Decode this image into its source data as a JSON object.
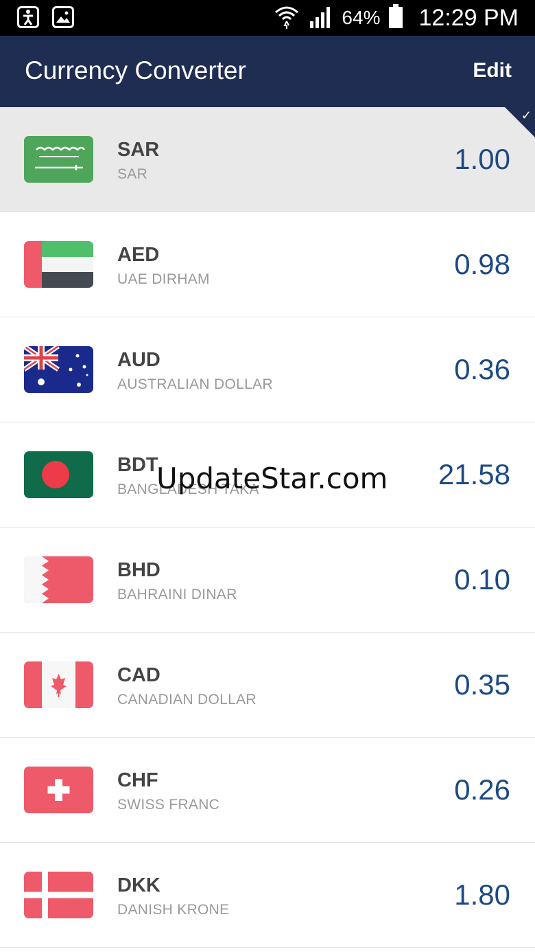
{
  "status_bar": {
    "battery": "64%",
    "time": "12:29 PM"
  },
  "app_bar": {
    "title": "Currency Converter",
    "edit_label": "Edit"
  },
  "currencies": [
    {
      "code": "SAR",
      "name": "SAR",
      "value": "1.00",
      "selected": true
    },
    {
      "code": "AED",
      "name": "UAE DIRHAM",
      "value": "0.98"
    },
    {
      "code": "AUD",
      "name": "AUSTRALIAN DOLLAR",
      "value": "0.36"
    },
    {
      "code": "BDT",
      "name": "BANGLADESH TAKA",
      "value": "21.58"
    },
    {
      "code": "BHD",
      "name": "BAHRAINI DINAR",
      "value": "0.10"
    },
    {
      "code": "CAD",
      "name": "CANADIAN DOLLAR",
      "value": "0.35"
    },
    {
      "code": "CHF",
      "name": "SWISS FRANC",
      "value": "0.26"
    },
    {
      "code": "DKK",
      "name": "DANISH KRONE",
      "value": "1.80"
    }
  ],
  "watermark": "UpdateStar.com",
  "colors": {
    "app_bar": "#1f2d52",
    "value_text": "#1d4a86",
    "selected_row": "#e9e9e9"
  }
}
